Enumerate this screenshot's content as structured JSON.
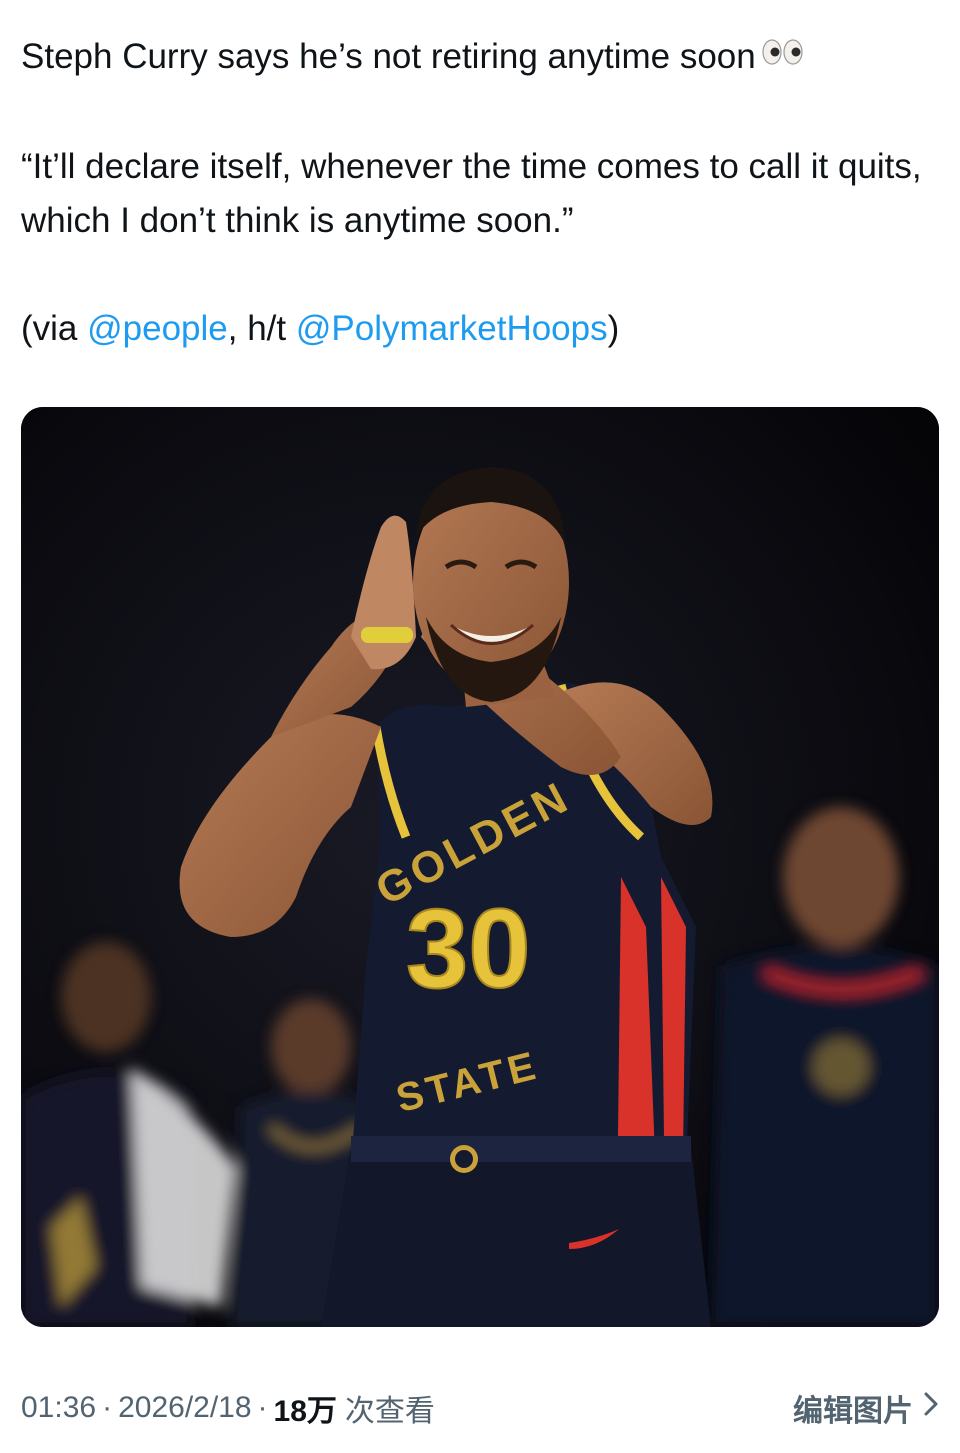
{
  "tweet": {
    "line1": "Steph Curry says he’s not retiring anytime soon",
    "emoji_icon": "eyes-emoji",
    "quote": "“It’ll declare itself, whenever the time comes to call it quits, which I don’t think is anytime soon.”",
    "via_prefix": "(via ",
    "mention_1": "@people",
    "via_middle": ", h/t ",
    "mention_2": "@PolymarketHoops",
    "via_suffix": ")"
  },
  "media": {
    "jersey_top": "GOLDEN",
    "jersey_number": "30",
    "jersey_bottom": "STATE",
    "colors": {
      "jersey_navy": "#141a30",
      "jersey_gold": "#e7c23b",
      "jersey_red": "#d8322b",
      "background": "#08080e"
    }
  },
  "meta": {
    "time": "01:36",
    "dot": "·",
    "date": "2026/2/18",
    "views_count": "18万",
    "views_label": "次查看",
    "edit_image_label": "编辑图片",
    "chevron_icon": "chevron-right-icon"
  },
  "colors": {
    "text": "#0f1419",
    "link": "#1d9bf0",
    "secondary": "#536471"
  }
}
